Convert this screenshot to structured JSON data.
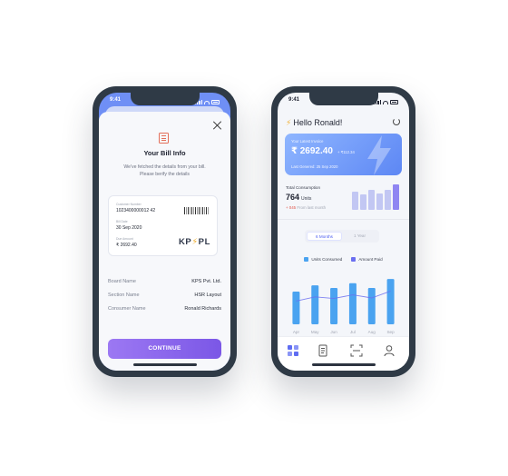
{
  "left_phone": {
    "status": {
      "time": "9:41"
    },
    "bill_info": {
      "title": "Your Bill Info",
      "subtitle_line1": "We've fetched the details from your bill.",
      "subtitle_line2": "Please berify the details",
      "card": {
        "customer_number_label": "Customer Number",
        "customer_number": "1023400000012 42",
        "bill_date_label": "Bill Date",
        "bill_date": "30 Sep 2020",
        "due_amount_label": "Due Amount",
        "due_amount": "₹ 2692.40",
        "logo_left": "KP",
        "logo_right": "PL"
      },
      "rows": [
        {
          "key": "Board Name",
          "value": "KPS Pvt. Ltd."
        },
        {
          "key": "Section Name",
          "value": "HSR Layout"
        },
        {
          "key": "Consumer Name",
          "value": "Ronald Richards"
        }
      ],
      "continue_label": "CONTINUE"
    }
  },
  "right_phone": {
    "status": {
      "time": "9:41"
    },
    "greeting": "Hello Ronald!",
    "invoice": {
      "label": "Your Latest Invoice",
      "amount": "₹ 2692.40",
      "delta": "+ ₹112.34",
      "date": "Last Genered: 25 Sep 2020"
    },
    "consumption": {
      "label": "Total Consumption",
      "value": "764",
      "unit": "Units",
      "delta_value": "+ 045",
      "delta_text": "From last month",
      "mini_bars": [
        0.7,
        0.62,
        0.78,
        0.66,
        0.8,
        1.0
      ]
    },
    "range_toggle": {
      "active": "6 Months",
      "inactive": "1 Year"
    },
    "legend": [
      {
        "name": "Units Consumed",
        "color": "#4aa3f0"
      },
      {
        "name": "Amount Paid",
        "color": "#6b6ff0"
      }
    ],
    "chart_data": {
      "type": "bar",
      "categories": [
        "Apr",
        "May",
        "Jun",
        "Jul",
        "Aug",
        "Sep"
      ],
      "series": [
        {
          "name": "Units Consumed",
          "values": [
            62,
            74,
            69,
            78,
            69,
            86
          ]
        },
        {
          "name": "Amount Paid",
          "values": [
            44,
            52,
            49,
            56,
            50,
            63
          ]
        }
      ],
      "ylim": [
        0,
        100
      ]
    },
    "tabbar": [
      "grid-icon",
      "bill-icon",
      "scan-icon",
      "user-icon"
    ]
  }
}
